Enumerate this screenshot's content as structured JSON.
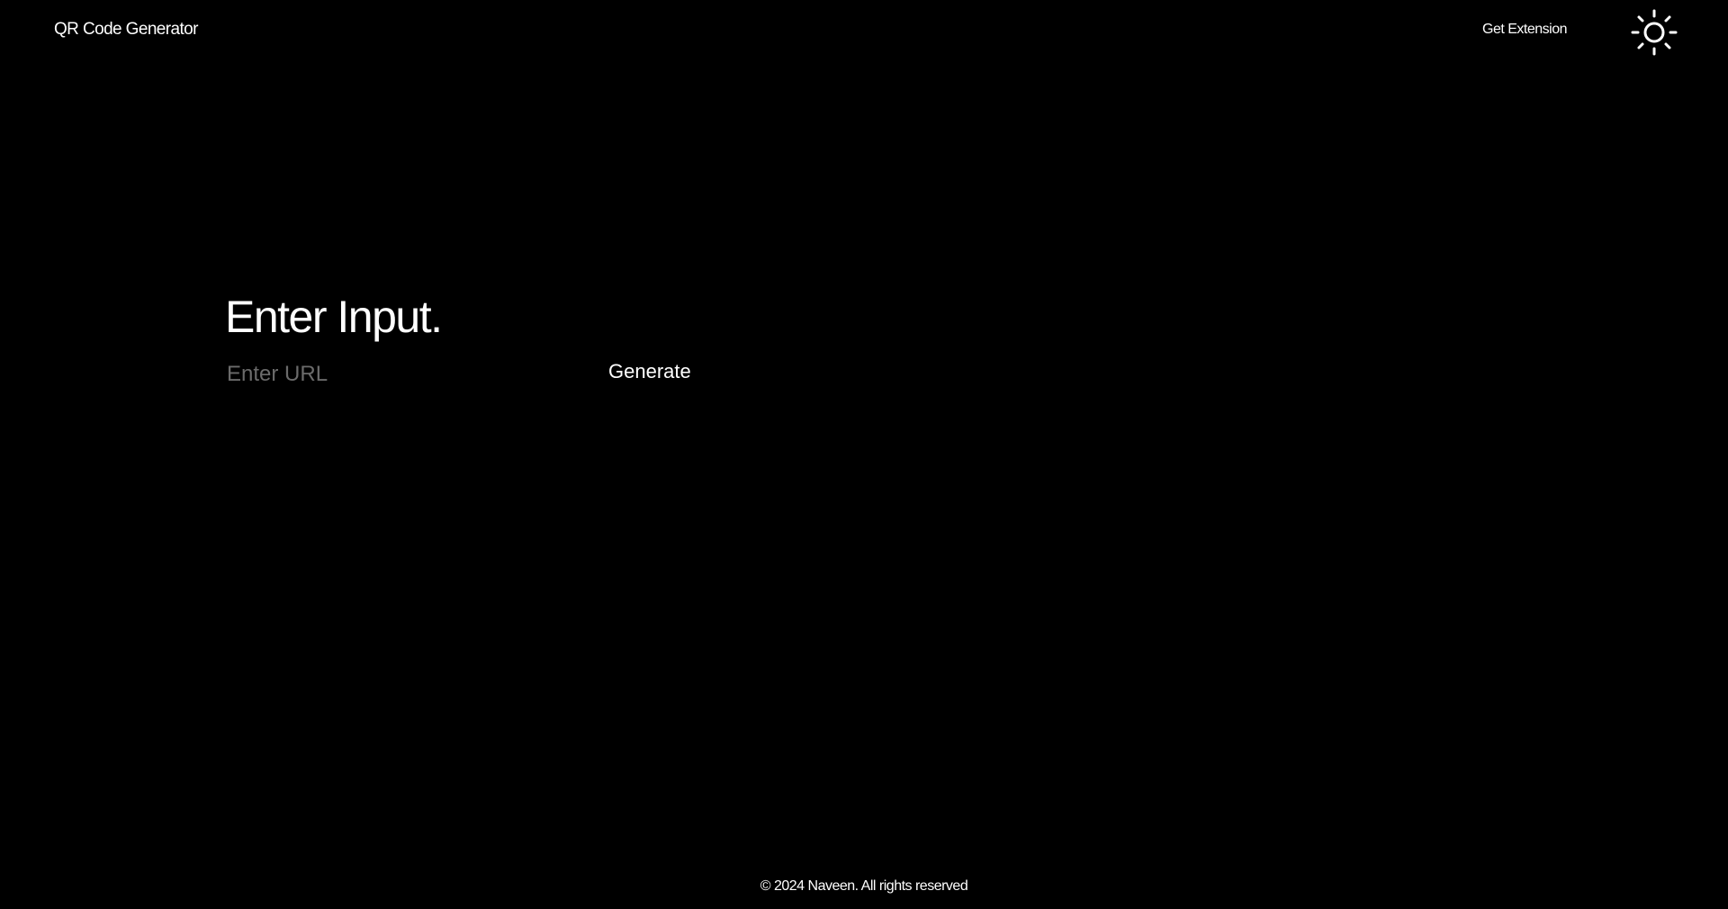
{
  "header": {
    "brand": "QR Code Generator",
    "nav_link": "Get Extension",
    "theme_toggle_icon": "sun-icon"
  },
  "main": {
    "title": "Enter Input.",
    "url_input": {
      "value": "",
      "placeholder": "Enter URL"
    },
    "generate_label": "Generate"
  },
  "footer": {
    "text": "© 2024 Naveen. All rights reserved"
  },
  "colors": {
    "background": "#000000",
    "text": "#ffffff",
    "placeholder": "#6b6b6b"
  }
}
